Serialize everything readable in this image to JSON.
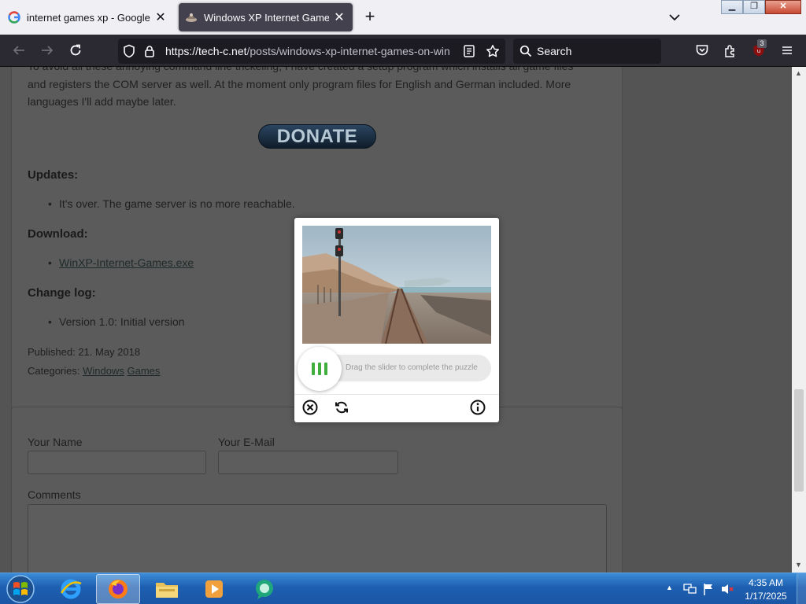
{
  "browser": {
    "tabs": [
      {
        "title": "internet games xp - Google Sea",
        "favicon": "google-g-icon",
        "active": false
      },
      {
        "title": "Windows XP Internet Games on",
        "favicon": "site-icon",
        "active": true
      }
    ],
    "new_tab_icon": "plus-icon",
    "url_host": "https://tech-c.net",
    "url_path": "/posts/windows-xp-internet-games-on-win",
    "search_placeholder": "Search",
    "extension_badge": "3"
  },
  "page": {
    "paragraph_line1": "To avoid all these annoying command line trickeling, I have created a setup program which installs all game files",
    "paragraph_line2": "and registers the COM server as well. At the moment only program files for English and German included. More",
    "paragraph_line3": "languages I'll add maybe later.",
    "donate_label": "DONATE",
    "updates_heading": "Updates:",
    "updates_item": "It's over. The game server is no more reachable.",
    "download_heading": "Download:",
    "download_link": "WinXP-Internet-Games.exe",
    "changelog_heading": "Change log:",
    "changelog_item": "Version 1.0: Initial version",
    "published": "Published: 21. May 2018",
    "categories_label": "Categories:",
    "category_1": "Windows",
    "category_2": "Games",
    "form": {
      "name_label": "Your Name",
      "email_label": "Your E-Mail",
      "comments_label": "Comments"
    }
  },
  "captcha": {
    "slider_hint": "Drag the slider to complete the puzzle",
    "slider_position": 0,
    "accent_color": "#3fae3f",
    "icons": [
      "close-circle-icon",
      "refresh-icon",
      "info-icon"
    ]
  },
  "taskbar": {
    "apps": [
      "internet-explorer-icon",
      "firefox-icon",
      "file-explorer-icon",
      "media-player-icon",
      "chat-app-icon"
    ],
    "time": "4:35 AM",
    "date": "1/17/2025"
  }
}
